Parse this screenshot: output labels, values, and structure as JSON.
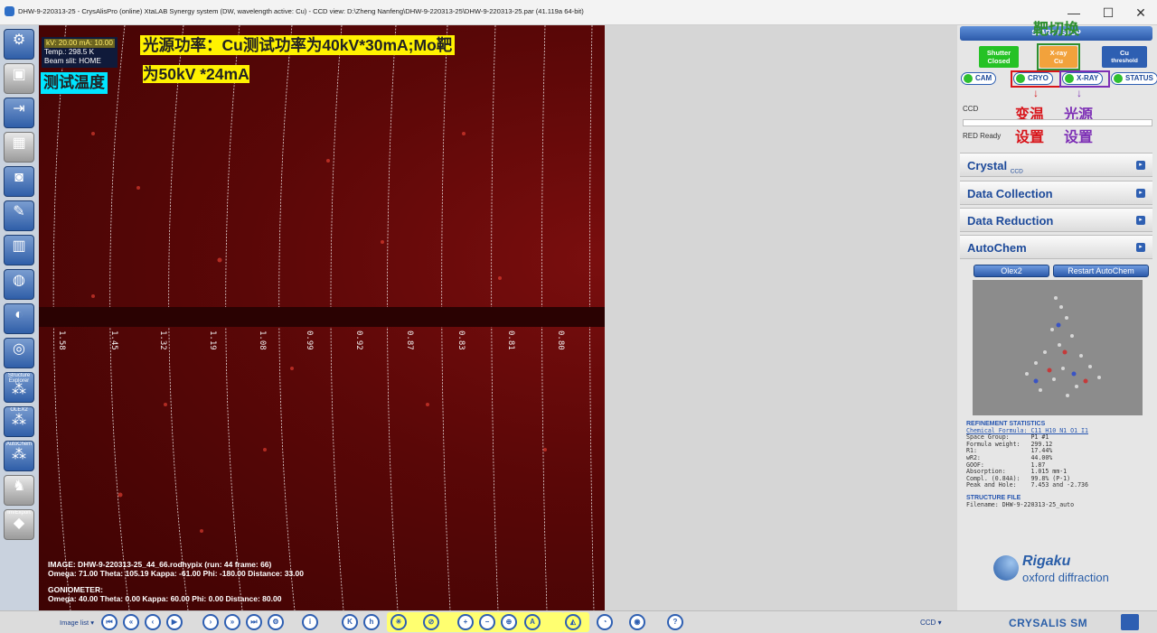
{
  "window": {
    "title": "DHW-9-220313-25 - CrysAlisPro (online) XtaLAB Synergy system (DW, wavelength active: Cu) - CCD view: D:\\Zheng Nanfeng\\DHW-9-220313-25\\DHW-9-220313-25.par  (41.119a 64-bit)",
    "minimize": "—",
    "maximize": "☐",
    "close": "✕"
  },
  "viewer": {
    "status": {
      "power": "kV: 20.00 mA: 10.00",
      "temp": "Temp.: 298.5 K",
      "beam_slit": "Beam slit: HOME"
    },
    "annotation_power": "光源功率：Cu测试功率为40kV*30mA;Mo靶",
    "annotation_power_line2": "为50kV *24mA",
    "annotation_temp": "测试温度",
    "resolution_ticks": [
      "1.58",
      "1.45",
      "1.32",
      "1.19",
      "1.08",
      "0.99",
      "0.92",
      "0.87",
      "0.83",
      "0.81",
      "0.80"
    ],
    "image_info": {
      "image": "IMAGE: DHW-9-220313-25_44_66.rodhypix (run: 44 frame: 66)",
      "angles": "Omega:  71.00   Theta: 105.19   Kappa:  -61.00   Phi: -180.00   Distance:  33.00",
      "gonio_title": "GONIOMETER:",
      "gonio_angles": "Omega:  40.00   Theta:   0.00   Kappa:  60.00   Phi:    0.00   Distance:  80.00"
    }
  },
  "leftbar": {
    "buttons": [
      "",
      "",
      "",
      "",
      "",
      "",
      "",
      "",
      "",
      "",
      "Structure Explorer",
      "OLEX2",
      "AutoChem",
      "",
      "Im/Export"
    ],
    "icons": [
      "goniometer-icon",
      "ccd-icon",
      "collect-icon",
      "grid-icon",
      "camera-icon",
      "wrench-icon",
      "chart-icon",
      "temperature-icon",
      "instrument-icon",
      "crystal-3d-icon",
      "structure-explorer-icon",
      "olex2-icon",
      "autochem-icon",
      "robot-icon",
      "import-export-icon"
    ]
  },
  "toolbar": {
    "image_list": "Image list",
    "ccd": "CCD"
  },
  "right": {
    "start_stop": "START / STOP",
    "shutter": "Shutter\nClosed",
    "shutter_l1": "Shutter",
    "shutter_l2": "Closed",
    "xray_l1": "X-ray",
    "xray_l2": "Cu",
    "cu_l1": "Cu",
    "cu_l2": "threshold",
    "annotation_switch": "靶切换",
    "pills": [
      "CAM",
      "CRYO",
      "X-RAY",
      "STATUS"
    ],
    "annotation_cryo_1": "变温",
    "annotation_cryo_2": "设置",
    "annotation_xray_1": "光源",
    "annotation_xray_2": "设置",
    "ccd_label": "CCD",
    "ready": "RED  Ready",
    "sections": [
      "Crystal",
      "Data Collection",
      "Data Reduction",
      "AutoChem"
    ],
    "crystal_sub": "CCD",
    "olex2": "Olex2",
    "restart": "Restart AutoChem",
    "refinement": {
      "title": "REFINEMENT STATISTICS",
      "formula": "Chemical Formula: C11 H10 N1 O1 I1",
      "lines": "Space Group:      P1 #1\nFormula weight:   299.12\nR1:               17.44%\nwR2:              44.00%\nGOOF:             1.87\nAbsorption:       1.015 mm-1\nCompl. (0.84A):   99.8% (P-1)\nPeak and Hole:    7.453 and -2.736"
    },
    "structure_file": {
      "title": "STRUCTURE FILE",
      "filename": "Filename: DHW-9-220313-25_auto"
    },
    "brand": "Rigaku",
    "brand_sub": "oxford diffraction",
    "product": "CRYSALIS SM"
  },
  "colors": {
    "accent": "#2e5fb2",
    "annotation_red": "#d8141a",
    "annotation_purple": "#7d2fb5",
    "annotation_green": "#2f8f2f",
    "highlight_yellow": "#fff200"
  }
}
